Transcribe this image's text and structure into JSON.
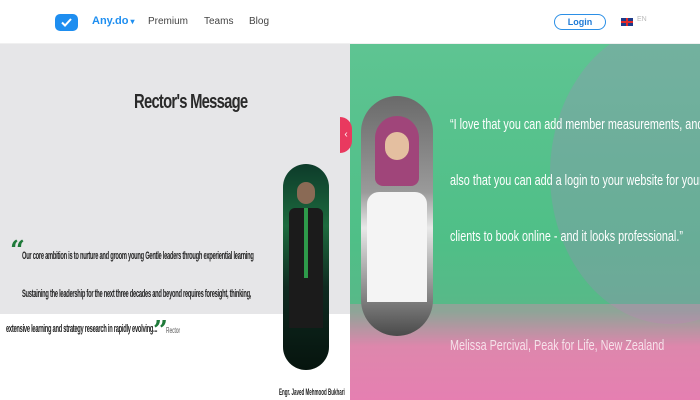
{
  "nav": {
    "brand": "Any.do",
    "brand_chevron": "▾",
    "links": [
      "Premium",
      "Teams",
      "Blog"
    ],
    "login": "Login",
    "lang": "EN"
  },
  "rector": {
    "title": "Rector's Message",
    "message_lines": [
      "Our core ambition is to nurture and groom young Gentle leaders through experiential learning",
      "Sustaining the leadership for the next three decades and beyond requires foresight, thinking,",
      "extensive learning and strategy research in rapidly evolving..."
    ],
    "signature": "Rector",
    "name": "Engr. Javed Mehmood Bukhari"
  },
  "testimonial": {
    "lines": [
      "“I love that you can add member measurements, and",
      "also that you can add a login to your website for your",
      "clients to book online - and it looks professional.”"
    ],
    "author": "Melissa Percival, Peak for Life, New Zealand"
  },
  "carousel": {
    "arrow": "‹"
  },
  "icons": {
    "logo": "checkmark-logo-icon",
    "flag": "uk-flag-icon",
    "arrow": "chevron-left-icon"
  },
  "colors": {
    "brand": "#1e8ef0",
    "testimonial_bg": "#5ec492",
    "arrow": "#e9395f",
    "quote_green": "#1f7a3a"
  }
}
